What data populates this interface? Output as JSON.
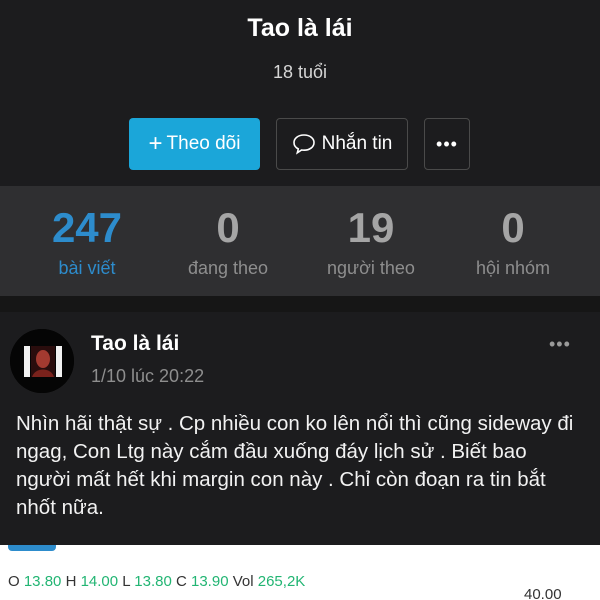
{
  "profile": {
    "name": "Tao là lái",
    "subtitle": "18 tuổi",
    "follow_label": "Theo dõi",
    "follow_icon": "plus-icon",
    "message_label": "Nhắn tin",
    "message_icon": "chat-bubble-icon",
    "more_label": "•••"
  },
  "stats": [
    {
      "value": "247",
      "label": "bài viết"
    },
    {
      "value": "0",
      "label": "đang theo"
    },
    {
      "value": "19",
      "label": "người theo"
    },
    {
      "value": "0",
      "label": "hội nhóm"
    }
  ],
  "post": {
    "author": "Tao là lái",
    "timestamp": "1/10 lúc 20:22",
    "more_label": "•••",
    "text": "Nhìn hãi thật sự . Cp nhiều con ko lên nổi thì cũng sideway đi ngag, Con Ltg này cắm đầu xuống đáy lịch sử . Biết bao người mất hết khi margin con này . Chỉ còn đoạn ra tin bắt nhốt nữa."
  },
  "chart": {
    "o_label": "O",
    "o_value": "13.80",
    "h_label": "H",
    "h_value": "14.00",
    "l_label": "L",
    "l_value": "13.80",
    "c_label": "C",
    "c_value": "13.90",
    "vol_label": "Vol",
    "vol_value": "265,2K",
    "price_tick": "40.00"
  },
  "colors": {
    "accent": "#1ba6d9",
    "active_stat": "#2d8ccc",
    "up": "#22b573"
  }
}
